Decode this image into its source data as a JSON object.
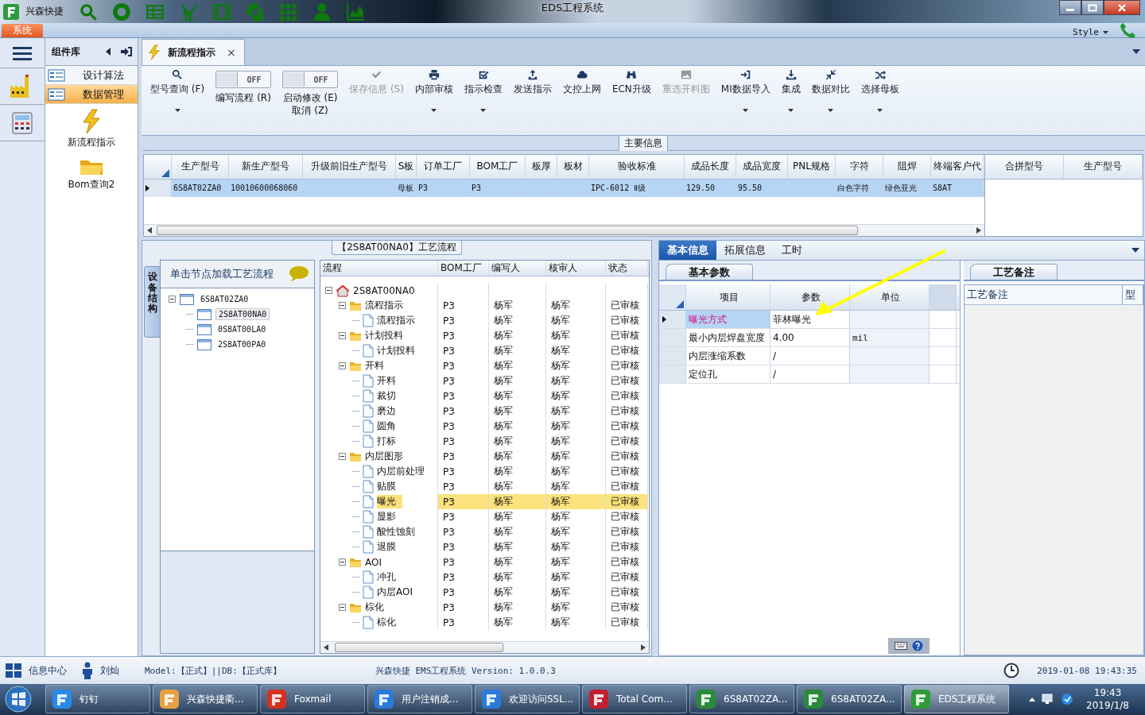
{
  "window": {
    "app_name": "兴森快捷",
    "title": "EDS工程系统"
  },
  "ribbon": {
    "tabs": [
      {
        "label": "系统",
        "selected": true
      }
    ],
    "style_label": "Style"
  },
  "sidebar": {
    "title": "组件库",
    "items": [
      {
        "label": "设计算法",
        "selected": false
      },
      {
        "label": "数据管理",
        "selected": true
      }
    ],
    "tiles": [
      {
        "label": "新流程指示"
      },
      {
        "label": "Bom查询2"
      }
    ]
  },
  "document_tab": {
    "label": "新流程指示",
    "close": "×",
    "selected": true
  },
  "toolbar": [
    {
      "kind": "button",
      "label": "型号查询 (F)",
      "dropdown": true,
      "disabled": false
    },
    {
      "kind": "toggle",
      "lines": [
        "编写流程 (R)"
      ],
      "switch_text": "OFF",
      "on": false
    },
    {
      "kind": "toggle",
      "lines": [
        "启动修改 (E)",
        "取消 (Z)"
      ],
      "switch_text": "OFF",
      "on": false
    },
    {
      "kind": "button",
      "label": "保存信息 (S)",
      "dropdown": false,
      "disabled": true
    },
    {
      "kind": "button",
      "label": "内部审核",
      "dropdown": true,
      "disabled": false
    },
    {
      "kind": "button",
      "label": "指示检查",
      "dropdown": true,
      "disabled": false
    },
    {
      "kind": "button",
      "label": "发送指示",
      "dropdown": false,
      "disabled": false
    },
    {
      "kind": "button",
      "label": "文控上网",
      "dropdown": false,
      "disabled": false
    },
    {
      "kind": "button",
      "label": "ECN升级",
      "dropdown": false,
      "disabled": false
    },
    {
      "kind": "button",
      "label": "重选开料图",
      "dropdown": false,
      "disabled": true
    },
    {
      "kind": "button",
      "label": "MI数据导入",
      "dropdown": true,
      "disabled": false
    },
    {
      "kind": "button",
      "label": "集成",
      "dropdown": true,
      "disabled": false
    },
    {
      "kind": "button",
      "label": "数据对比",
      "dropdown": true,
      "disabled": false
    },
    {
      "kind": "button",
      "label": "选择母板",
      "dropdown": true,
      "disabled": false
    }
  ],
  "main_info": {
    "title": "主要信息",
    "columns": [
      "生产型号",
      "新生产型号",
      "升级前旧生产型号",
      "S板",
      "订单工厂",
      "BOM工厂",
      "板厚",
      "板材",
      "验收标准",
      "成品长度",
      "成品宽度",
      "PNL规格",
      "字符",
      "阻焊",
      "终端客户代"
    ],
    "rows": [
      {
        "selected": true,
        "cells": [
          "6S8AT02ZA0",
          "10010600068060",
          null,
          "母板",
          "P3",
          "P3",
          null,
          null,
          "IPC-6012 Ⅱ级",
          "129.50",
          "95.50",
          null,
          "白色字符",
          "绿色亚光",
          "S8AT"
        ]
      }
    ],
    "side_columns": [
      "合拼型号",
      "生产型号"
    ]
  },
  "flow_panel": {
    "title": "【2S8AT00NA0】工艺流程",
    "side_tab": "设备结构",
    "tree_header": "单击节点加载工艺流程",
    "equipment_tree": [
      {
        "label": "6S8AT02ZA0",
        "expanded": true,
        "selected": false,
        "children": [
          {
            "label": "2S8AT00NA0",
            "selected": true
          },
          {
            "label": "0S8AT00LA0",
            "selected": false
          },
          {
            "label": "2S8AT00PA0",
            "selected": false
          }
        ]
      }
    ],
    "flow_grid": {
      "columns": [
        "流程",
        "BOM工厂",
        "编写人",
        "核审人",
        "状态"
      ],
      "rows": [
        {
          "label": "2S8AT00NA0",
          "kind": "root",
          "expanded": true,
          "selected": false,
          "children": [
            {
              "label": "流程指示",
              "kind": "folder",
              "bom": "P3",
              "writer": "杨军",
              "reviewer": "杨军",
              "status": "已审核",
              "expanded": true,
              "selected": false,
              "children": [
                {
                  "label": "流程指示",
                  "kind": "doc",
                  "bom": "P3",
                  "writer": "杨军",
                  "reviewer": "杨军",
                  "status": "已审核",
                  "selected": false
                }
              ]
            },
            {
              "label": "计划投料",
              "kind": "folder",
              "bom": "P3",
              "writer": "杨军",
              "reviewer": "杨军",
              "status": "已审核",
              "expanded": true,
              "selected": false,
              "children": [
                {
                  "label": "计划投料",
                  "kind": "doc",
                  "bom": "P3",
                  "writer": "杨军",
                  "reviewer": "杨军",
                  "status": "已审核",
                  "selected": false
                }
              ]
            },
            {
              "label": "开料",
              "kind": "folder",
              "bom": "P3",
              "writer": "杨军",
              "reviewer": "杨军",
              "status": "已审核",
              "expanded": true,
              "selected": false,
              "children": [
                {
                  "label": "开料",
                  "kind": "doc",
                  "bom": "P3",
                  "writer": "杨军",
                  "reviewer": "杨军",
                  "status": "已审核",
                  "selected": false
                },
                {
                  "label": "裁切",
                  "kind": "doc",
                  "bom": "P3",
                  "writer": "杨军",
                  "reviewer": "杨军",
                  "status": "已审核",
                  "selected": false
                },
                {
                  "label": "磨边",
                  "kind": "doc",
                  "bom": "P3",
                  "writer": "杨军",
                  "reviewer": "杨军",
                  "status": "已审核",
                  "selected": false
                },
                {
                  "label": "圆角",
                  "kind": "doc",
                  "bom": "P3",
                  "writer": "杨军",
                  "reviewer": "杨军",
                  "status": "已审核",
                  "selected": false
                },
                {
                  "label": "打标",
                  "kind": "doc",
                  "bom": "P3",
                  "writer": "杨军",
                  "reviewer": "杨军",
                  "status": "已审核",
                  "selected": false
                }
              ]
            },
            {
              "label": "内层图形",
              "kind": "folder",
              "bom": "P3",
              "writer": "杨军",
              "reviewer": "杨军",
              "status": "已审核",
              "expanded": true,
              "selected": false,
              "children": [
                {
                  "label": "内层前处理",
                  "kind": "doc",
                  "bom": "P3",
                  "writer": "杨军",
                  "reviewer": "杨军",
                  "status": "已审核",
                  "selected": false
                },
                {
                  "label": "贴膜",
                  "kind": "doc",
                  "bom": "P3",
                  "writer": "杨军",
                  "reviewer": "杨军",
                  "status": "已审核",
                  "selected": false
                },
                {
                  "label": "曝光",
                  "kind": "doc",
                  "bom": "P3",
                  "writer": "杨军",
                  "reviewer": "杨军",
                  "status": "已审核",
                  "selected": true
                },
                {
                  "label": "显影",
                  "kind": "doc",
                  "bom": "P3",
                  "writer": "杨军",
                  "reviewer": "杨军",
                  "status": "已审核",
                  "selected": false
                },
                {
                  "label": "酸性蚀刻",
                  "kind": "doc",
                  "bom": "P3",
                  "writer": "杨军",
                  "reviewer": "杨军",
                  "status": "已审核",
                  "selected": false
                },
                {
                  "label": "退膜",
                  "kind": "doc",
                  "bom": "P3",
                  "writer": "杨军",
                  "reviewer": "杨军",
                  "status": "已审核",
                  "selected": false
                }
              ]
            },
            {
              "label": "AOI",
              "kind": "folder",
              "bom": "P3",
              "writer": "杨军",
              "reviewer": "杨军",
              "status": "已审核",
              "expanded": true,
              "selected": false,
              "children": [
                {
                  "label": "冲孔",
                  "kind": "doc",
                  "bom": "P3",
                  "writer": "杨军",
                  "reviewer": "杨军",
                  "status": "已审核",
                  "selected": false
                },
                {
                  "label": "内层AOI",
                  "kind": "doc",
                  "bom": "P3",
                  "writer": "杨军",
                  "reviewer": "杨军",
                  "status": "已审核",
                  "selected": false
                }
              ]
            },
            {
              "label": "棕化",
              "kind": "folder",
              "bom": "P3",
              "writer": "杨军",
              "reviewer": "杨军",
              "status": "已审核",
              "expanded": true,
              "selected": false,
              "children": [
                {
                  "label": "棕化",
                  "kind": "doc",
                  "bom": "P3",
                  "writer": "杨军",
                  "reviewer": "杨军",
                  "status": "已审核",
                  "selected": false
                }
              ]
            }
          ]
        }
      ]
    }
  },
  "detail_panel": {
    "tabs": [
      {
        "label": "基本信息",
        "selected": true
      },
      {
        "label": "拓展信息",
        "selected": false
      },
      {
        "label": "工时",
        "selected": false
      }
    ],
    "params_tab": "基本参数",
    "params": {
      "columns": [
        "项目",
        "参数",
        "单位"
      ],
      "rows": [
        {
          "item": "曝光方式",
          "value": "菲林曝光",
          "selected": true
        },
        {
          "item": "最小内层焊盘宽度",
          "value": "4.00",
          "unit": "mil",
          "selected": false
        },
        {
          "item": "内层涨缩系数",
          "value": "/",
          "selected": false
        },
        {
          "item": "定位孔",
          "value": "/",
          "selected": false
        }
      ]
    },
    "notes_tab": "工艺备注",
    "notes_columns": [
      "工艺备注",
      "型"
    ]
  },
  "status_bar": {
    "info_center": "信息中心",
    "user": "刘灿",
    "model": "Model:【正式】||DB:【正式库】",
    "product": "兴森快捷 EMS工程系统 Version: 1.0.0.3",
    "datetime": "2019-01-08 19:43:35"
  },
  "taskbar": {
    "items": [
      {
        "label": "钉钉",
        "selected": false
      },
      {
        "label": "兴森快捷衢...",
        "selected": false
      },
      {
        "label": "Foxmail",
        "selected": false
      },
      {
        "label": "用户注销成...",
        "selected": false
      },
      {
        "label": "欢迎访问SSL...",
        "selected": false
      },
      {
        "label": "Total Com...",
        "selected": false
      },
      {
        "label": "6S8AT02ZA...",
        "selected": false
      },
      {
        "label": "6S8AT02ZA...",
        "selected": false
      },
      {
        "label": "EDS工程系统",
        "selected": true
      }
    ],
    "time": "19:43",
    "date": "2019/1/8"
  }
}
